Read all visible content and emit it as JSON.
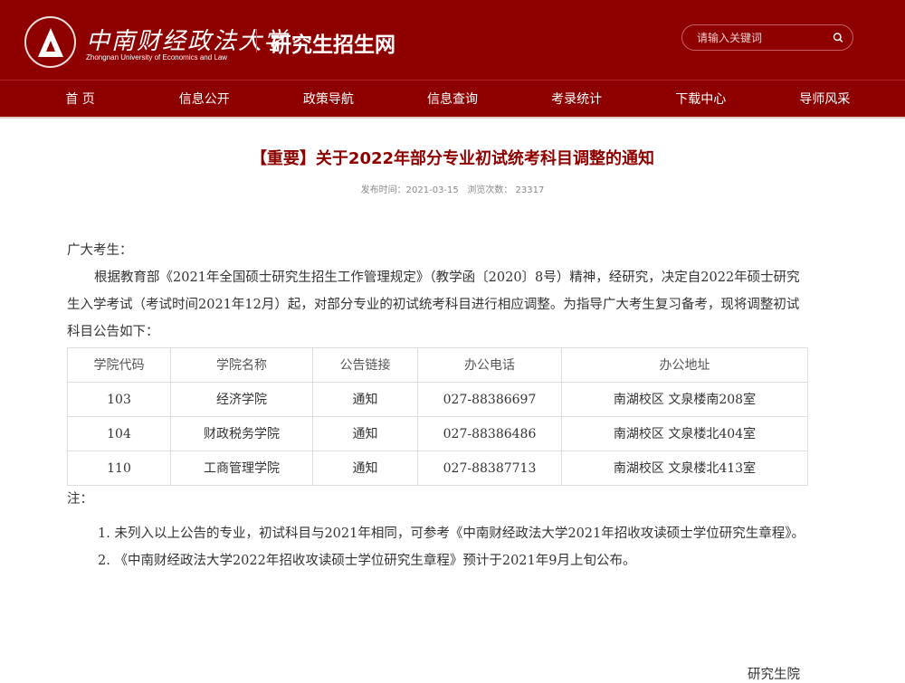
{
  "header": {
    "university_cn": "中南财经政法大学",
    "university_en": "Zhongnan University of Economics and Law",
    "site_title": "研究生招生网",
    "search_placeholder": "请输入关键词"
  },
  "nav": [
    "首 页",
    "信息公开",
    "政策导航",
    "信息查询",
    "考录统计",
    "下载中心",
    "导师风采"
  ],
  "article": {
    "title": "【重要】关于2022年部分专业初试统考科目调整的通知",
    "publish_label": "发布时间：",
    "publish_date": "2021-03-15",
    "views_label": "浏览次数：",
    "views": "23317",
    "greeting": "广大考生：",
    "para": "根据教育部《2021年全国硕士研究生招生工作管理规定》（教学函〔2020〕8号）精神，经研究，决定自2022年硕士研究生入学考试（考试时间2021年12月）起，对部分专业的初试统考科目进行相应调整。为指导广大考生复习备考，现将调整初试科目公告如下：",
    "table": {
      "headers": [
        "学院代码",
        "学院名称",
        "公告链接",
        "办公电话",
        "办公地址"
      ],
      "rows": [
        [
          "103",
          "经济学院",
          "通知",
          "027-88386697",
          "南湖校区 文泉楼南208室"
        ],
        [
          "104",
          "财政税务学院",
          "通知",
          "027-88386486",
          "南湖校区 文泉楼北404室"
        ],
        [
          "110",
          "工商管理学院",
          "通知",
          "027-88387713",
          "南湖校区 文泉楼北413室"
        ]
      ]
    },
    "note_label": "注：",
    "notes": [
      "1. 未列入以上公告的专业，初试科目与2021年相同，可参考《中南财经政法大学2021年招收攻读硕士学位研究生章程》。",
      "2. 《中南财经政法大学2022年招收攻读硕士学位研究生章程》预计于2021年9月上旬公布。"
    ],
    "signature": "研究生院"
  }
}
